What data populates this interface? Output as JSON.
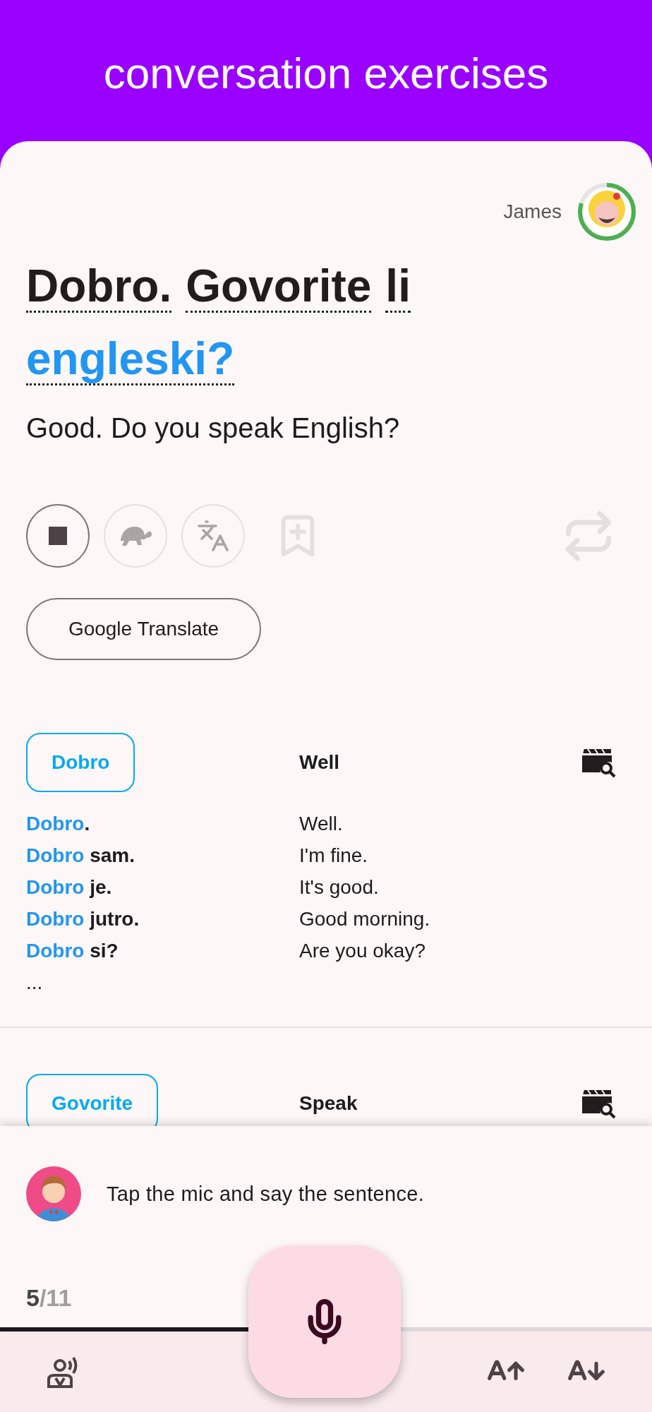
{
  "header": {
    "title": "conversation exercises"
  },
  "user": {
    "name": "James"
  },
  "sentence": {
    "words": [
      {
        "text": "Dobro.",
        "highlighted": false
      },
      {
        "text": "Govorite",
        "highlighted": false
      },
      {
        "text": "li",
        "highlighted": false
      },
      {
        "text": "engleski?",
        "highlighted": true
      }
    ],
    "translation": "Good. Do you speak English?"
  },
  "actions": [
    {
      "kind": "stop",
      "disabled": false
    },
    {
      "kind": "slow",
      "disabled": true
    },
    {
      "kind": "translate",
      "disabled": true
    },
    {
      "kind": "bookmark",
      "disabled": true
    },
    {
      "kind": "repeat",
      "disabled": true
    }
  ],
  "translate_button": "Google Translate",
  "entries": [
    {
      "word": "Dobro",
      "meaning": "Well",
      "examples": [
        {
          "key": "Dobro",
          "rest": ".",
          "translation": "Well."
        },
        {
          "key": "Dobro",
          "rest": " sam.",
          "translation": "I'm fine."
        },
        {
          "key": "Dobro",
          "rest": " je.",
          "translation": "It's good."
        },
        {
          "key": "Dobro",
          "rest": " jutro.",
          "translation": "Good morning."
        },
        {
          "key": "Dobro",
          "rest": " si?",
          "translation": "Are you okay?"
        }
      ],
      "more": "..."
    },
    {
      "word": "Govorite",
      "meaning": "Speak"
    }
  ],
  "prompt": {
    "message": "Tap the mic and say the sentence."
  },
  "progress": {
    "current": "5",
    "total_text": "/11"
  }
}
